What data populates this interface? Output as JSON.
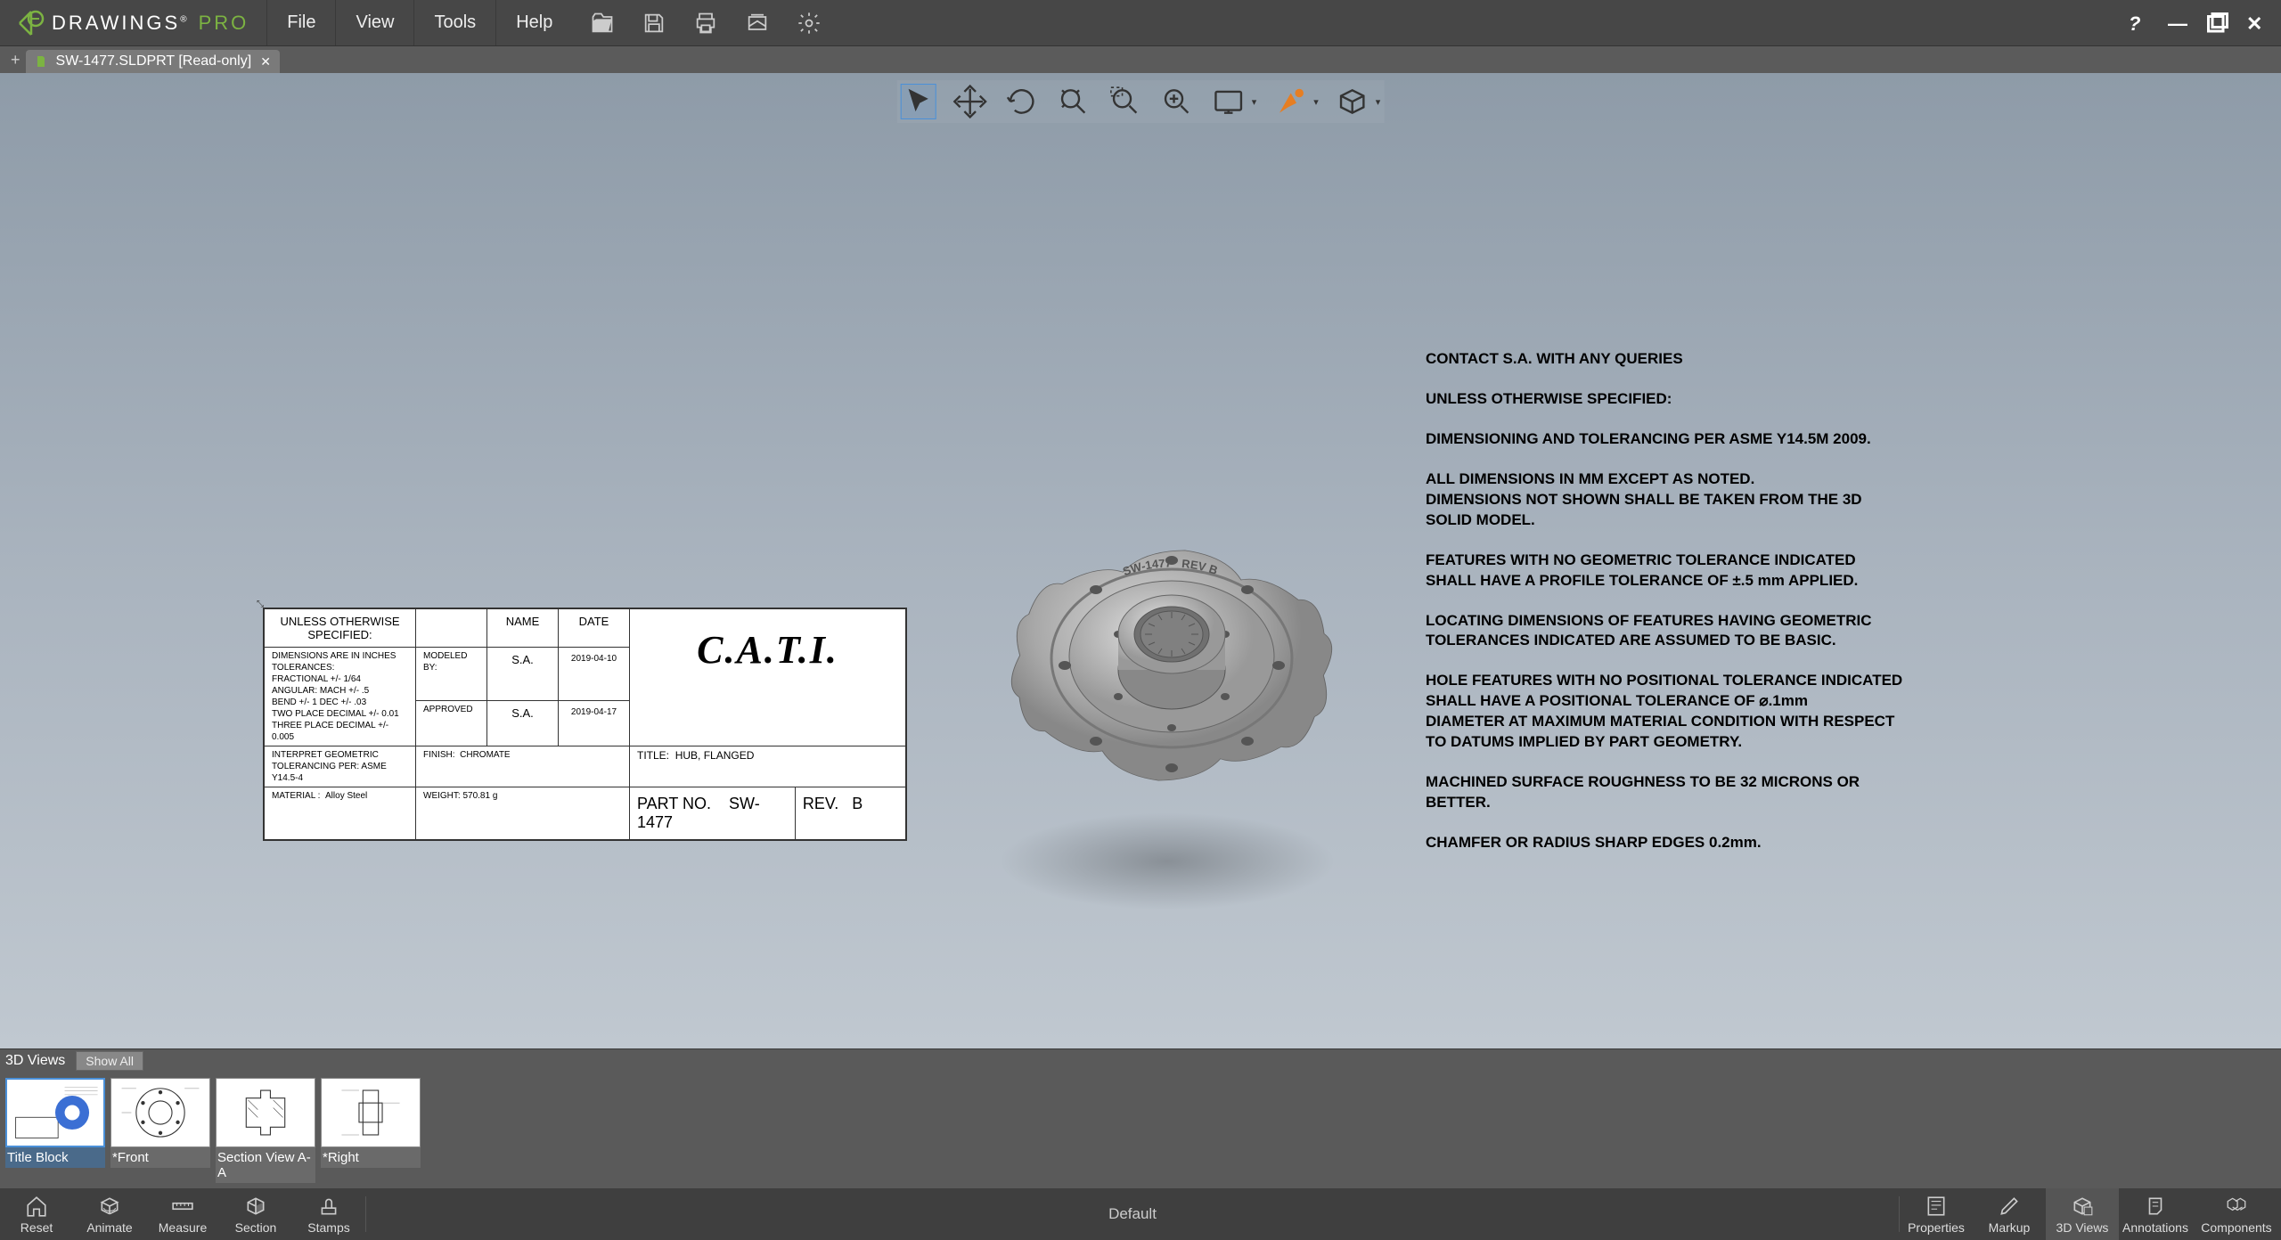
{
  "app": {
    "name": "DRAWINGS",
    "suffix": "PRO"
  },
  "menus": [
    "File",
    "View",
    "Tools",
    "Help"
  ],
  "tab": {
    "label": "SW-1477.SLDPRT [Read-only]"
  },
  "views_panel": {
    "title": "3D Views",
    "show_all": "Show All"
  },
  "thumbs": [
    {
      "label": "Title Block"
    },
    {
      "label": "*Front"
    },
    {
      "label": "Section View A-A"
    },
    {
      "label": "*Right"
    }
  ],
  "bottom_left": [
    "Reset",
    "Animate",
    "Measure",
    "Section",
    "Stamps"
  ],
  "bottom_center": "Default",
  "bottom_right": [
    "Properties",
    "Markup",
    "3D Views",
    "Annotations",
    "Components"
  ],
  "title_block": {
    "unless": "UNLESS OTHERWISE SPECIFIED:",
    "col_name": "NAME",
    "col_date": "DATE",
    "tolerances": "DIMENSIONS ARE IN INCHES\nTOLERANCES:\nFRACTIONAL +/- 1/64\nANGULAR: MACH +/- .5\nBEND +/- 1 DEC +/- .03\nTWO PLACE DECIMAL   +/- 0.01\nTHREE PLACE DECIMAL +/- 0.005",
    "modeled_by_label": "MODELED BY:",
    "modeled_by_name": "S.A.",
    "modeled_by_date": "2019-04-10",
    "approved_label": "APPROVED",
    "approved_name": "S.A.",
    "approved_date": "2019-04-17",
    "interpret": "INTERPRET GEOMETRIC\nTOLERANCING PER: ASME Y14.5-4",
    "finish_label": "FINISH:",
    "finish_value": "CHROMATE",
    "material_label": "MATERIAL :",
    "material_value": "Alloy Steel",
    "weight_label": "WEIGHT:",
    "weight_value": "570.81 g",
    "company": "C.A.T.I.",
    "title_label": "TITLE:",
    "title_value": "HUB, FLANGED",
    "partno_label": "PART NO.",
    "partno_value": "SW-1477",
    "rev_label": "REV.",
    "rev_value": "B"
  },
  "notes": [
    "CONTACT  S.A. WITH ANY QUERIES",
    "UNLESS OTHERWISE SPECIFIED:",
    "DIMENSIONING AND TOLERANCING PER ASME Y14.5M 2009.",
    "ALL DIMENSIONS IN MM EXCEPT AS NOTED.\nDIMENSIONS NOT SHOWN SHALL BE TAKEN FROM THE 3D SOLID MODEL.",
    "FEATURES WITH NO GEOMETRIC TOLERANCE INDICATED SHALL HAVE A PROFILE TOLERANCE OF ±.5  mm APPLIED.",
    "LOCATING DIMENSIONS OF FEATURES HAVING GEOMETRIC TOLERANCES INDICATED ARE ASSUMED TO BE BASIC.",
    "HOLE FEATURES WITH NO POSITIONAL TOLERANCE INDICATED SHALL HAVE A POSITIONAL TOLERANCE OF ⌀.1mm\nDIAMETER AT MAXIMUM MATERIAL CONDITION WITH RESPECT TO DATUMS IMPLIED BY PART GEOMETRY.",
    "MACHINED SURFACE ROUGHNESS TO BE 32 MICRONS OR BETTER.",
    "CHAMFER OR RADIUS SHARP EDGES 0.2mm."
  ],
  "model_label": {
    "part": "SW-1477",
    "rev": "REV B"
  }
}
